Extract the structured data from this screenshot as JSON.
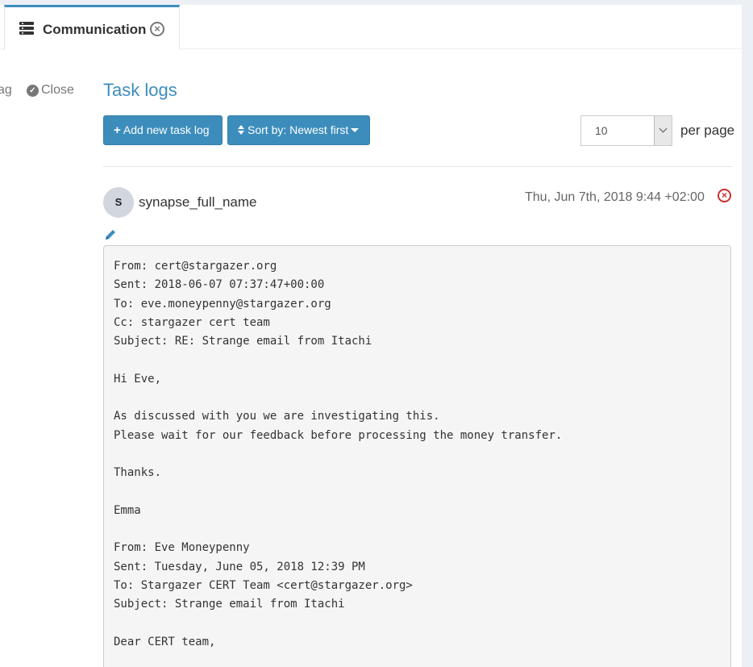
{
  "tab": {
    "label": "Communication",
    "icon": "tasks-icon",
    "close_icon": "close-circle-icon"
  },
  "left_actions": {
    "flag_label": "ag",
    "close_label": "Close"
  },
  "section": {
    "title": "Task logs"
  },
  "toolbar": {
    "add_label": "Add new task log",
    "add_prefix": "+",
    "sort_label": "Sort by: Newest first"
  },
  "pagination": {
    "per_page_value": "10",
    "per_page_label": "per page"
  },
  "log": {
    "avatar_letter": "S",
    "author": "synapse_full_name",
    "date": "Thu, Jun 7th, 2018 9:44 +02:00",
    "body": "From: cert@stargazer.org\nSent: 2018-06-07 07:37:47+00:00\nTo: eve.moneypenny@stargazer.org\nCc: stargazer cert team\nSubject: RE: Strange email from Itachi\n\nHi Eve,\n\nAs discussed with you we are investigating this.\nPlease wait for our feedback before processing the money transfer.\n\nThanks.\n\nEmma\n\nFrom: Eve Moneypenny\nSent: Tuesday, June 05, 2018 12:39 PM\nTo: Stargazer CERT Team <cert@stargazer.org>\nSubject: Strange email from Itachi\n\nDear CERT team,"
  },
  "colors": {
    "accent": "#3c8dbc",
    "danger": "#c9302c"
  }
}
